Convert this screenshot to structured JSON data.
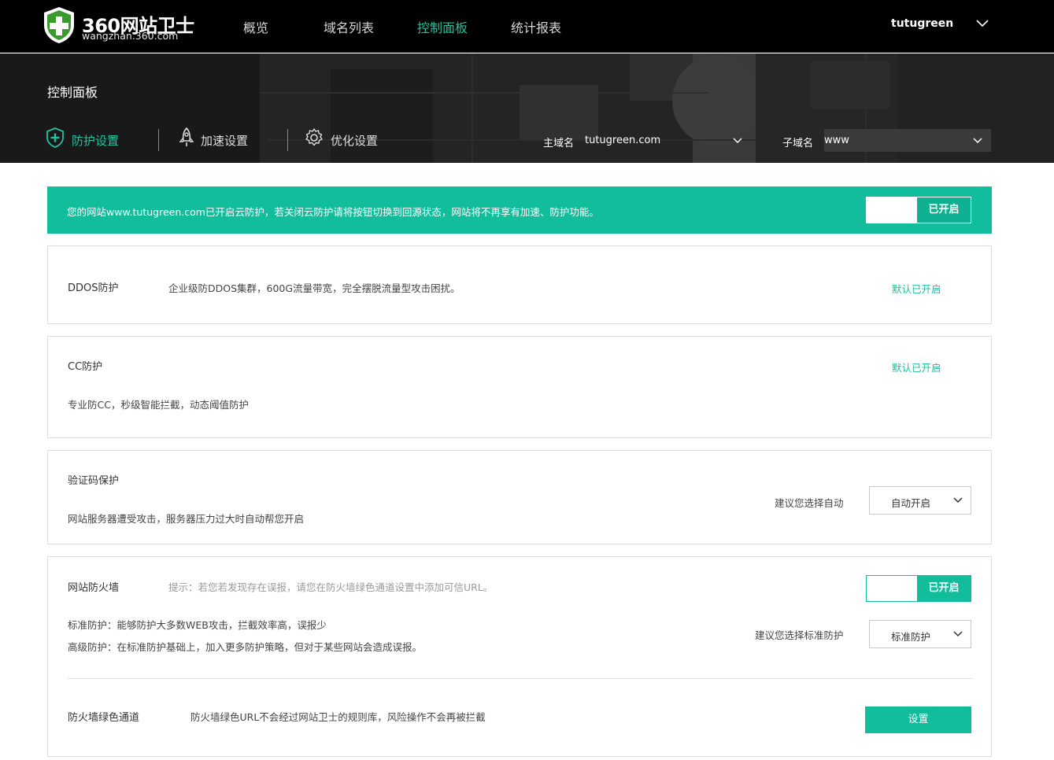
{
  "header": {
    "logo_title": "360网站卫士",
    "logo_subtitle": "wangzhan.360.com",
    "nav": [
      {
        "label": "概览",
        "active": false
      },
      {
        "label": "域名列表",
        "active": false
      },
      {
        "label": "控制面板",
        "active": true
      },
      {
        "label": "统计报表",
        "active": false
      }
    ],
    "username": "tutugreen"
  },
  "banner": {
    "title": "控制面板",
    "tabs": [
      {
        "label": "防护设置",
        "icon": "shield-plus-icon",
        "active": true
      },
      {
        "label": "加速设置",
        "icon": "rocket-icon",
        "active": false
      },
      {
        "label": "优化设置",
        "icon": "gear-icon",
        "active": false
      }
    ],
    "main_domain_label": "主域名",
    "main_domain_value": "tutugreen.com",
    "sub_domain_label": "子域名",
    "sub_domain_value": "www"
  },
  "alert": {
    "text": "您的网站www.tutugreen.com已开启云防护，若关闭云防护请将按钮切换到回源状态，网站将不再享有加速、防护功能。",
    "toggle_label": "已开启"
  },
  "ddos": {
    "title": "DDOS防护",
    "desc": "企业级防DDOS集群，600G流量带宽，完全摆脱流量型攻击困扰。",
    "status": "默认已开启"
  },
  "cc": {
    "title": "CC防护",
    "desc": "专业防CC，秒级智能拦截，动态阈值防护",
    "status": "默认已开启"
  },
  "captcha": {
    "title": "验证码保护",
    "desc": "网站服务器遭受攻击，服务器压力过大时自动帮您开启",
    "suggest": "建议您选择自动",
    "select_value": "自动开启"
  },
  "firewall": {
    "title": "网站防火墙",
    "hint": "提示：若您若发现存在误报，请您在防火墙绿色通道设置中添加可信URL。",
    "toggle_label": "已开启",
    "std_desc": "标准防护：能够防护大多数WEB攻击，拦截效率高，误报少",
    "adv_desc": "高级防护：在标准防护基础上，加入更多防护策略，但对于某些网站会造成误报。",
    "suggest": "建议您选择标准防护",
    "select_value": "标准防护",
    "green_title": "防火墙绿色通道",
    "green_desc": "防火墙绿色URL不会经过网站卫士的规则库，风险操作不会再被拦截",
    "green_button": "设置"
  },
  "colors": {
    "accent": "#12bd9c",
    "topbar": "#000000",
    "banner": "#1a1a1a"
  }
}
